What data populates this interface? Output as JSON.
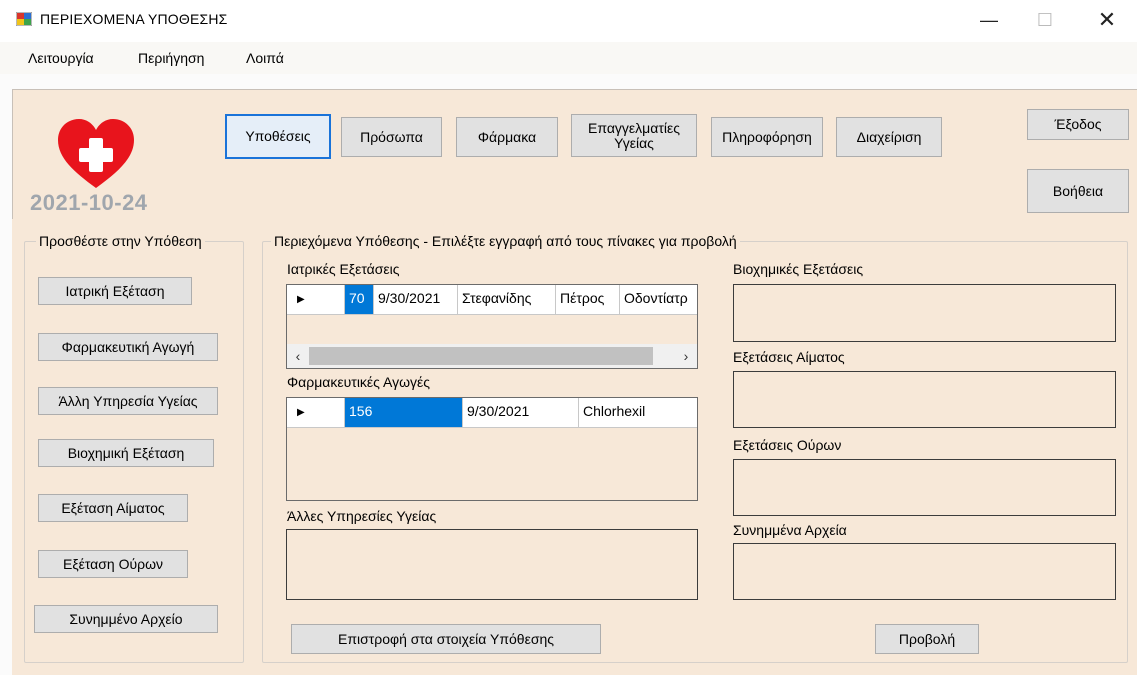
{
  "window": {
    "title": "ΠΕΡΙΕΧΟΜΕΝΑ ΥΠΟΘΕΣΗΣ",
    "minimize": "—",
    "maximize": "☐",
    "close": "✕"
  },
  "menu": [
    "Λειτουργία",
    "Περιήγηση",
    "Λοιπά"
  ],
  "header": {
    "date": "2021-10-24",
    "nav_buttons": [
      "Υποθέσεις",
      "Πρόσωπα",
      "Φάρμακα",
      "Επαγγελματίες\nΥγείας",
      "Πληροφόρηση",
      "Διαχείριση"
    ],
    "exit_label": "Έξοδος",
    "help_label": "Βοήθεια"
  },
  "add_group": {
    "title": "Προσθέστε στην Υπόθεση",
    "buttons": [
      "Ιατρική Εξέταση",
      "Φαρμακευτική Αγωγή",
      "Άλλη Υπηρεσία Υγείας",
      "Βιοχημική Εξέταση",
      "Εξέταση Αίματος",
      "Εξέταση Ούρων",
      "Συνημμένο Αρχείο"
    ]
  },
  "contents_group": {
    "title": "Περιεχόμενα Υπόθεσης - Επιλέξτε εγγραφή από τους πίνακες για προβολή",
    "medical_exams": {
      "label": "Ιατρικές Εξετάσεις",
      "rows": [
        [
          "70",
          "9/30/2021",
          "Στεφανίδης",
          "Πέτρος",
          "Οδοντίατρ"
        ]
      ]
    },
    "pharma": {
      "label": "Φαρμακευτικές Αγωγές",
      "rows": [
        [
          "156",
          "9/30/2021",
          "Chlorhexil"
        ]
      ]
    },
    "other_services_label": "Άλλες Υπηρεσίες Υγείας",
    "biochem_label": "Βιοχημικές Εξετάσεις",
    "blood_label": "Εξετάσεις Αίματος",
    "urine_label": "Εξετάσεις Ούρων",
    "attachments_label": "Συνημμένα Αρχεία",
    "back_button": "Επιστροφή στα στοιχεία Υπόθεσης",
    "view_button": "Προβολή"
  },
  "colors": {
    "panel": "#f7e8d8",
    "selection": "#0078d7",
    "heart": "#e8141c"
  }
}
